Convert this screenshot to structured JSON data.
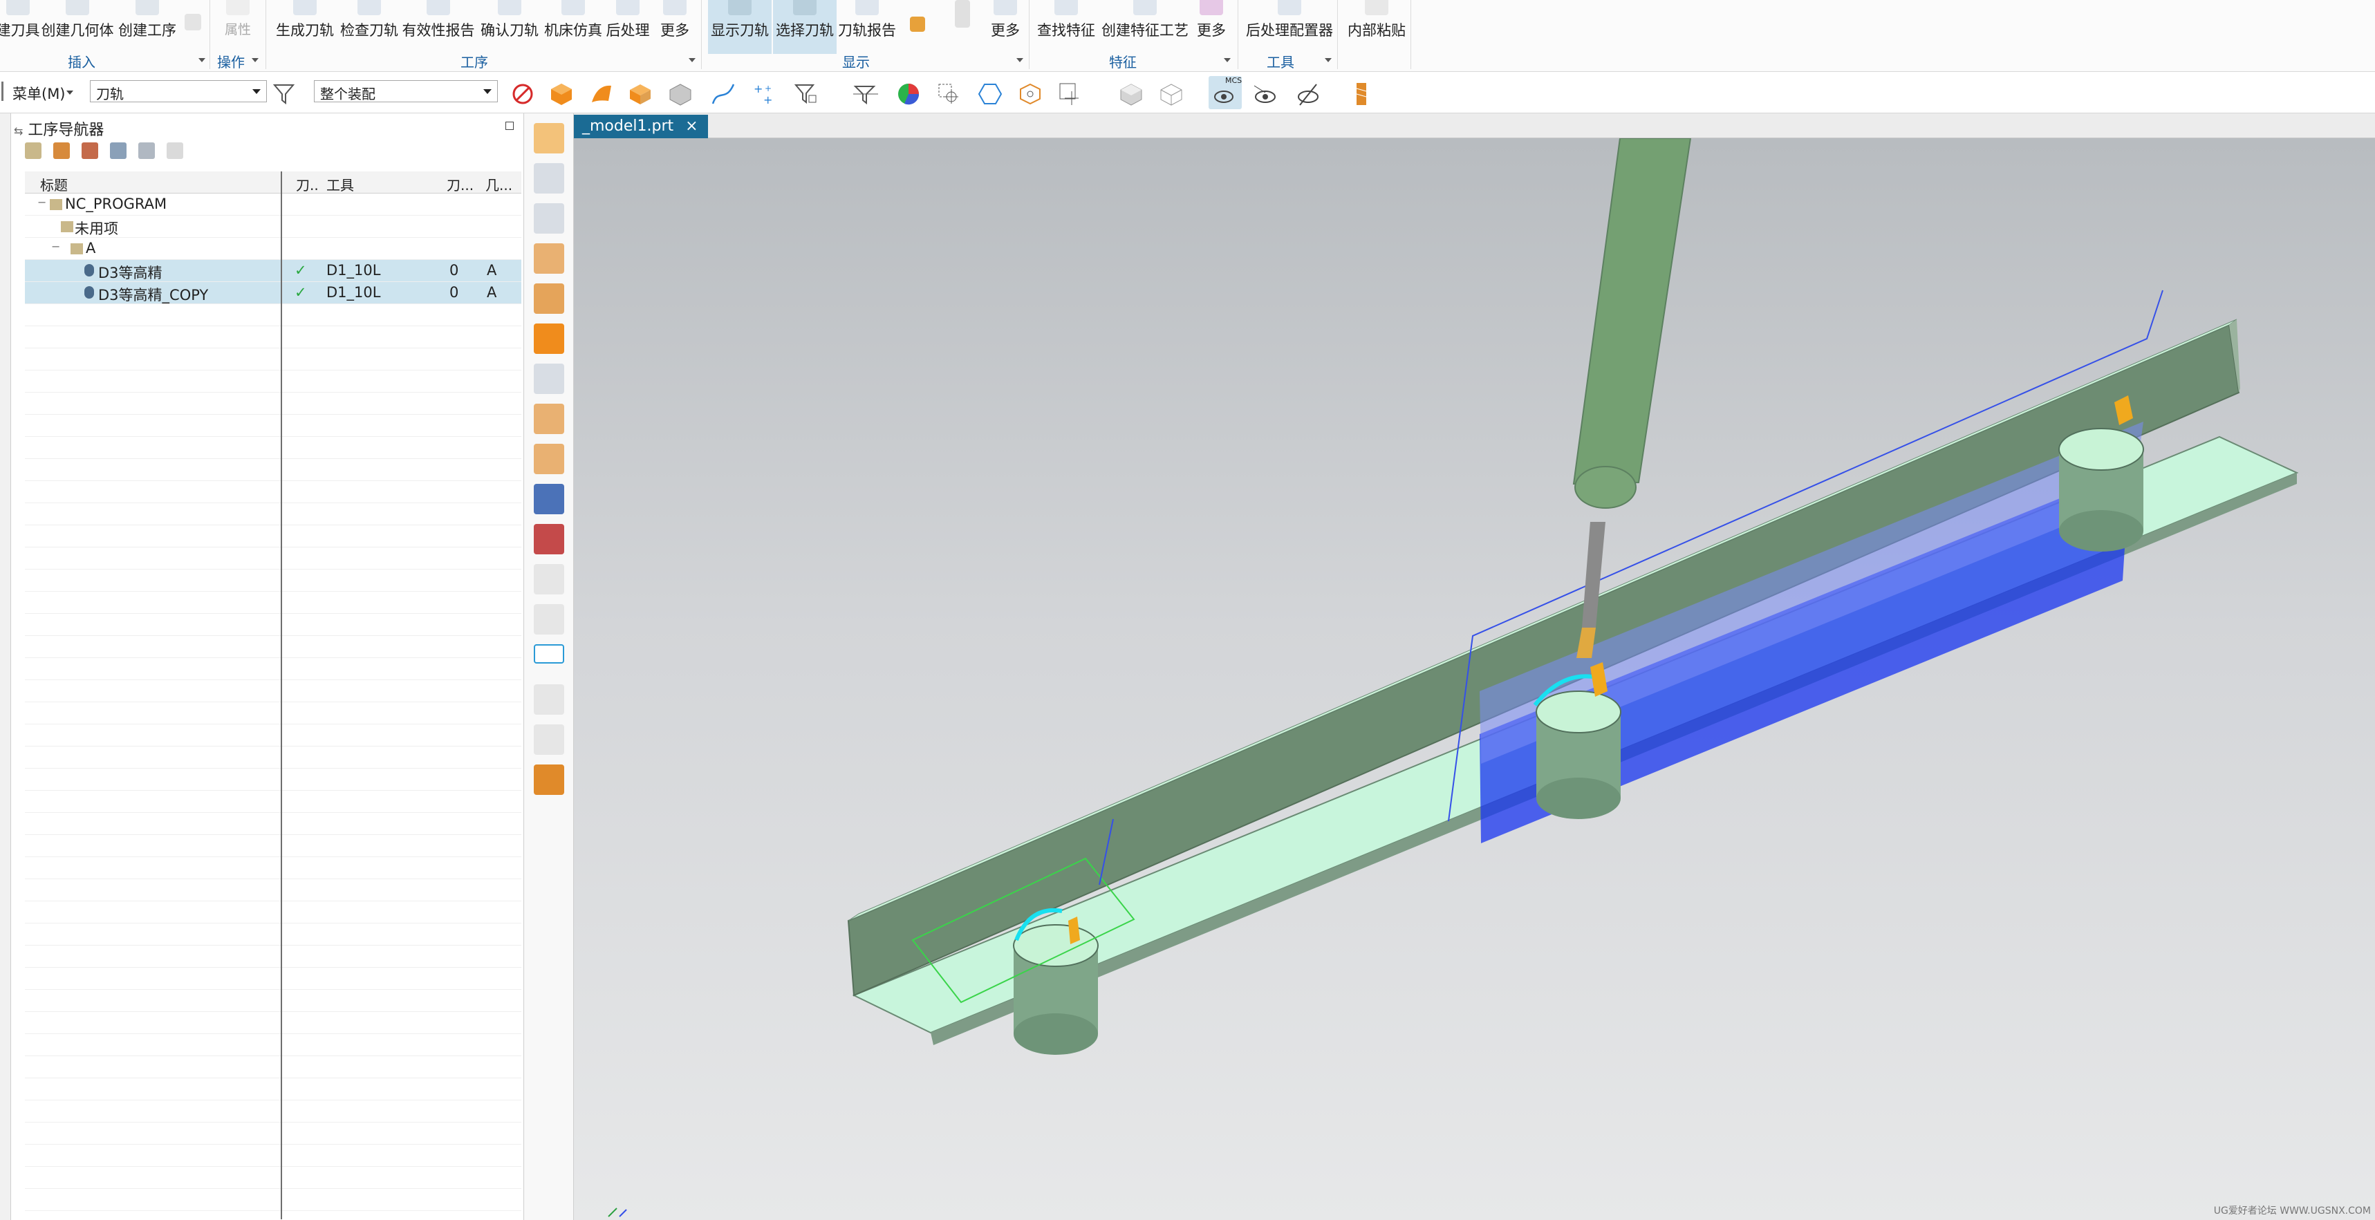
{
  "ribbon": {
    "insert_buttons": [
      "建刀具",
      "创建几何体",
      "创建工序"
    ],
    "op_buttons_gray": "属性",
    "process_buttons": [
      "生成刀轨",
      "检查刀轨",
      "有效性报告",
      "确认刀轨",
      "机床仿真",
      "后处理",
      "更多"
    ],
    "display_buttons": [
      "显示刀轨",
      "选择刀轨",
      "刀轨报告",
      "更多"
    ],
    "feature_buttons": [
      "查找特征",
      "创建特征工艺",
      "更多"
    ],
    "tools_buttons": [
      "后处理配置器"
    ],
    "clipboard_button": "内部粘贴",
    "groups": [
      "插入",
      "操作",
      "工序",
      "显示",
      "特征",
      "工具"
    ]
  },
  "toolbar2": {
    "menu_label": "菜单(M)",
    "filter_value": "刀轨",
    "scope_value": "整个装配",
    "mcs_label": "MCS"
  },
  "navigator": {
    "title": "工序导航器",
    "columns": [
      "标题",
      "刀..",
      "工具",
      "刀...",
      "几..."
    ],
    "rows": [
      {
        "name": "NC_PROGRAM",
        "check": "",
        "tool": "",
        "num": "",
        "geo": ""
      },
      {
        "name": "未用项",
        "check": "",
        "tool": "",
        "num": "",
        "geo": ""
      },
      {
        "name": "A",
        "check": "",
        "tool": "",
        "num": "",
        "geo": ""
      },
      {
        "name": "D3等高精",
        "check": "✓",
        "tool": "D1_10L",
        "num": "0",
        "geo": "A"
      },
      {
        "name": "D3等高精_COPY",
        "check": "✓",
        "tool": "D1_10L",
        "num": "0",
        "geo": "A"
      }
    ]
  },
  "viewport": {
    "tab_label": "_model1.prt",
    "tab_close": "×",
    "watermark": "UG爱好者论坛 WWW.UGSNX.COM"
  }
}
